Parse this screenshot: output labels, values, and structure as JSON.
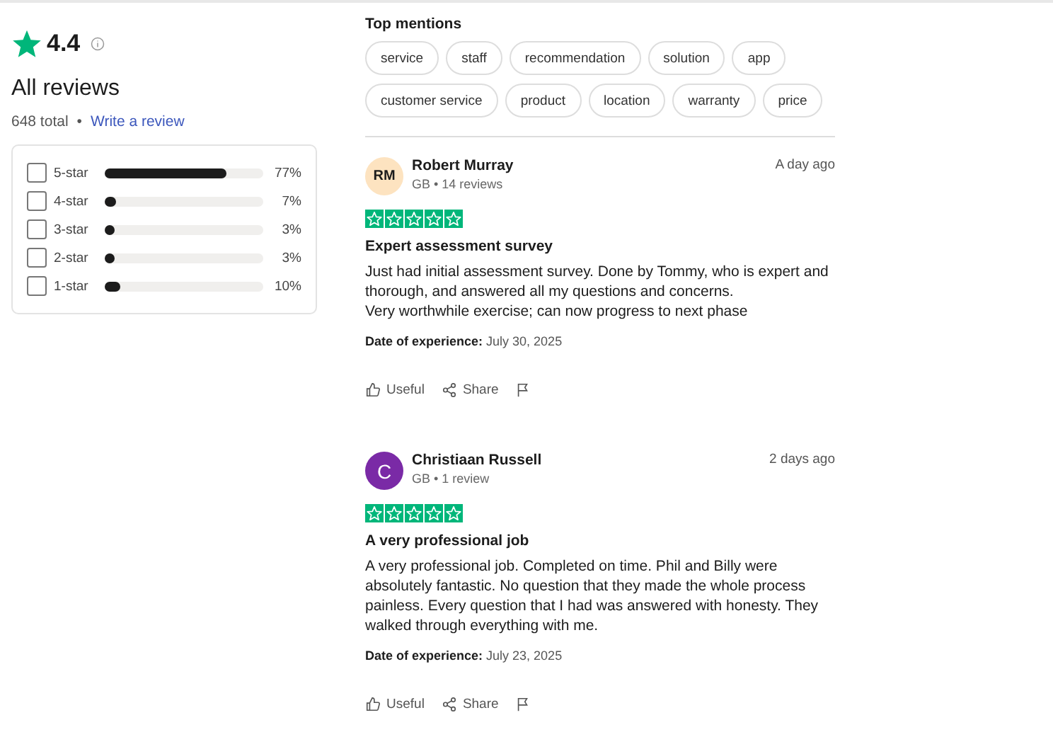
{
  "summary": {
    "rating": "4.4",
    "heading": "All reviews",
    "total": "648 total",
    "separator": "•",
    "write_link": "Write a review"
  },
  "distribution": [
    {
      "label": "5-star",
      "checked": false,
      "level": 0.77,
      "percent": "77%"
    },
    {
      "label": "4-star",
      "checked": false,
      "level": 0.07,
      "percent": "7%"
    },
    {
      "label": "3-star",
      "checked": false,
      "level": 0.03,
      "percent": "3%"
    },
    {
      "label": "2-star",
      "checked": false,
      "level": 0.03,
      "percent": "3%"
    },
    {
      "label": "1-star",
      "checked": false,
      "level": 0.1,
      "percent": "10%"
    }
  ],
  "top_mentions": {
    "title": "Top mentions",
    "chips": [
      [
        "service",
        "staff",
        "recommendation",
        "solution",
        "app"
      ],
      [
        "customer service",
        "product",
        "location",
        "warranty",
        "price"
      ]
    ]
  },
  "reviews": [
    {
      "initials": "RM",
      "color": "#fde3c0",
      "name": "Robert Murray",
      "meta": "GB • 14 reviews",
      "time": "A day ago",
      "stars": 5,
      "title": "Expert assessment survey",
      "body": [
        "Just had initial assessment survey. Done by Tommy, who is expert and thorough, and answered all my questions and concerns.",
        "Very worthwhile exercise; can now progress to next phase"
      ],
      "date": "**Date of experience:** July 30, 2025",
      "useful": "Useful",
      "share": "Share"
    },
    {
      "initials": "C",
      "color": "#7a2aa6",
      "name": "Christiaan Russell",
      "meta": "GB • 1 review",
      "time": "2 days ago",
      "stars": 5,
      "title": "A very professional job",
      "body": [
        "A very professional job. Completed on time. Phil and Billy were absolutely fantastic. No question that they made the whole process painless. Every question that I had was answered with honesty. They walked through everything with me."
      ],
      "date": "**Date of experience:** July 23, 2025",
      "useful": "Useful",
      "share": "Share"
    }
  ]
}
